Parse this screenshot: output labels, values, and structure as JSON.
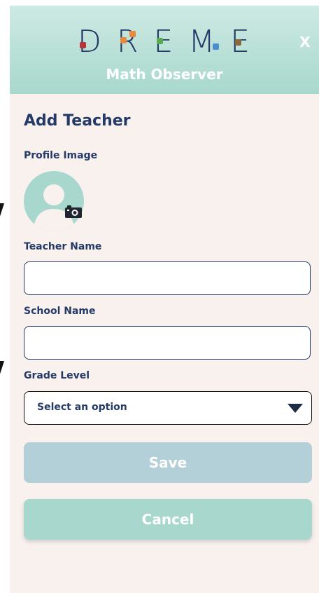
{
  "header": {
    "logo_text": "DREME",
    "subtitle": "Math Observer",
    "close_label": "X",
    "logo_dot_colors": [
      "#b5363f",
      "#e8893e",
      "#5aaa52",
      "#4a8fcf",
      "#8a6a3c"
    ]
  },
  "form": {
    "title": "Add Teacher",
    "profile_image_label": "Profile Image",
    "teacher_name_label": "Teacher Name",
    "teacher_name_value": "",
    "school_name_label": "School Name",
    "school_name_value": "",
    "grade_level_label": "Grade Level",
    "grade_level_selected": "Select an option"
  },
  "buttons": {
    "save_label": "Save",
    "cancel_label": "Cancel"
  },
  "colors": {
    "header_bg": "#a8d8cd",
    "navy": "#253a67",
    "panel_bg": "#f8f1ee",
    "save_bg": "#b3d0d8",
    "cancel_bg": "#a8d8cd"
  },
  "icons": [
    "person-avatar-icon",
    "camera-icon",
    "caret-down-icon",
    "close-icon"
  ]
}
